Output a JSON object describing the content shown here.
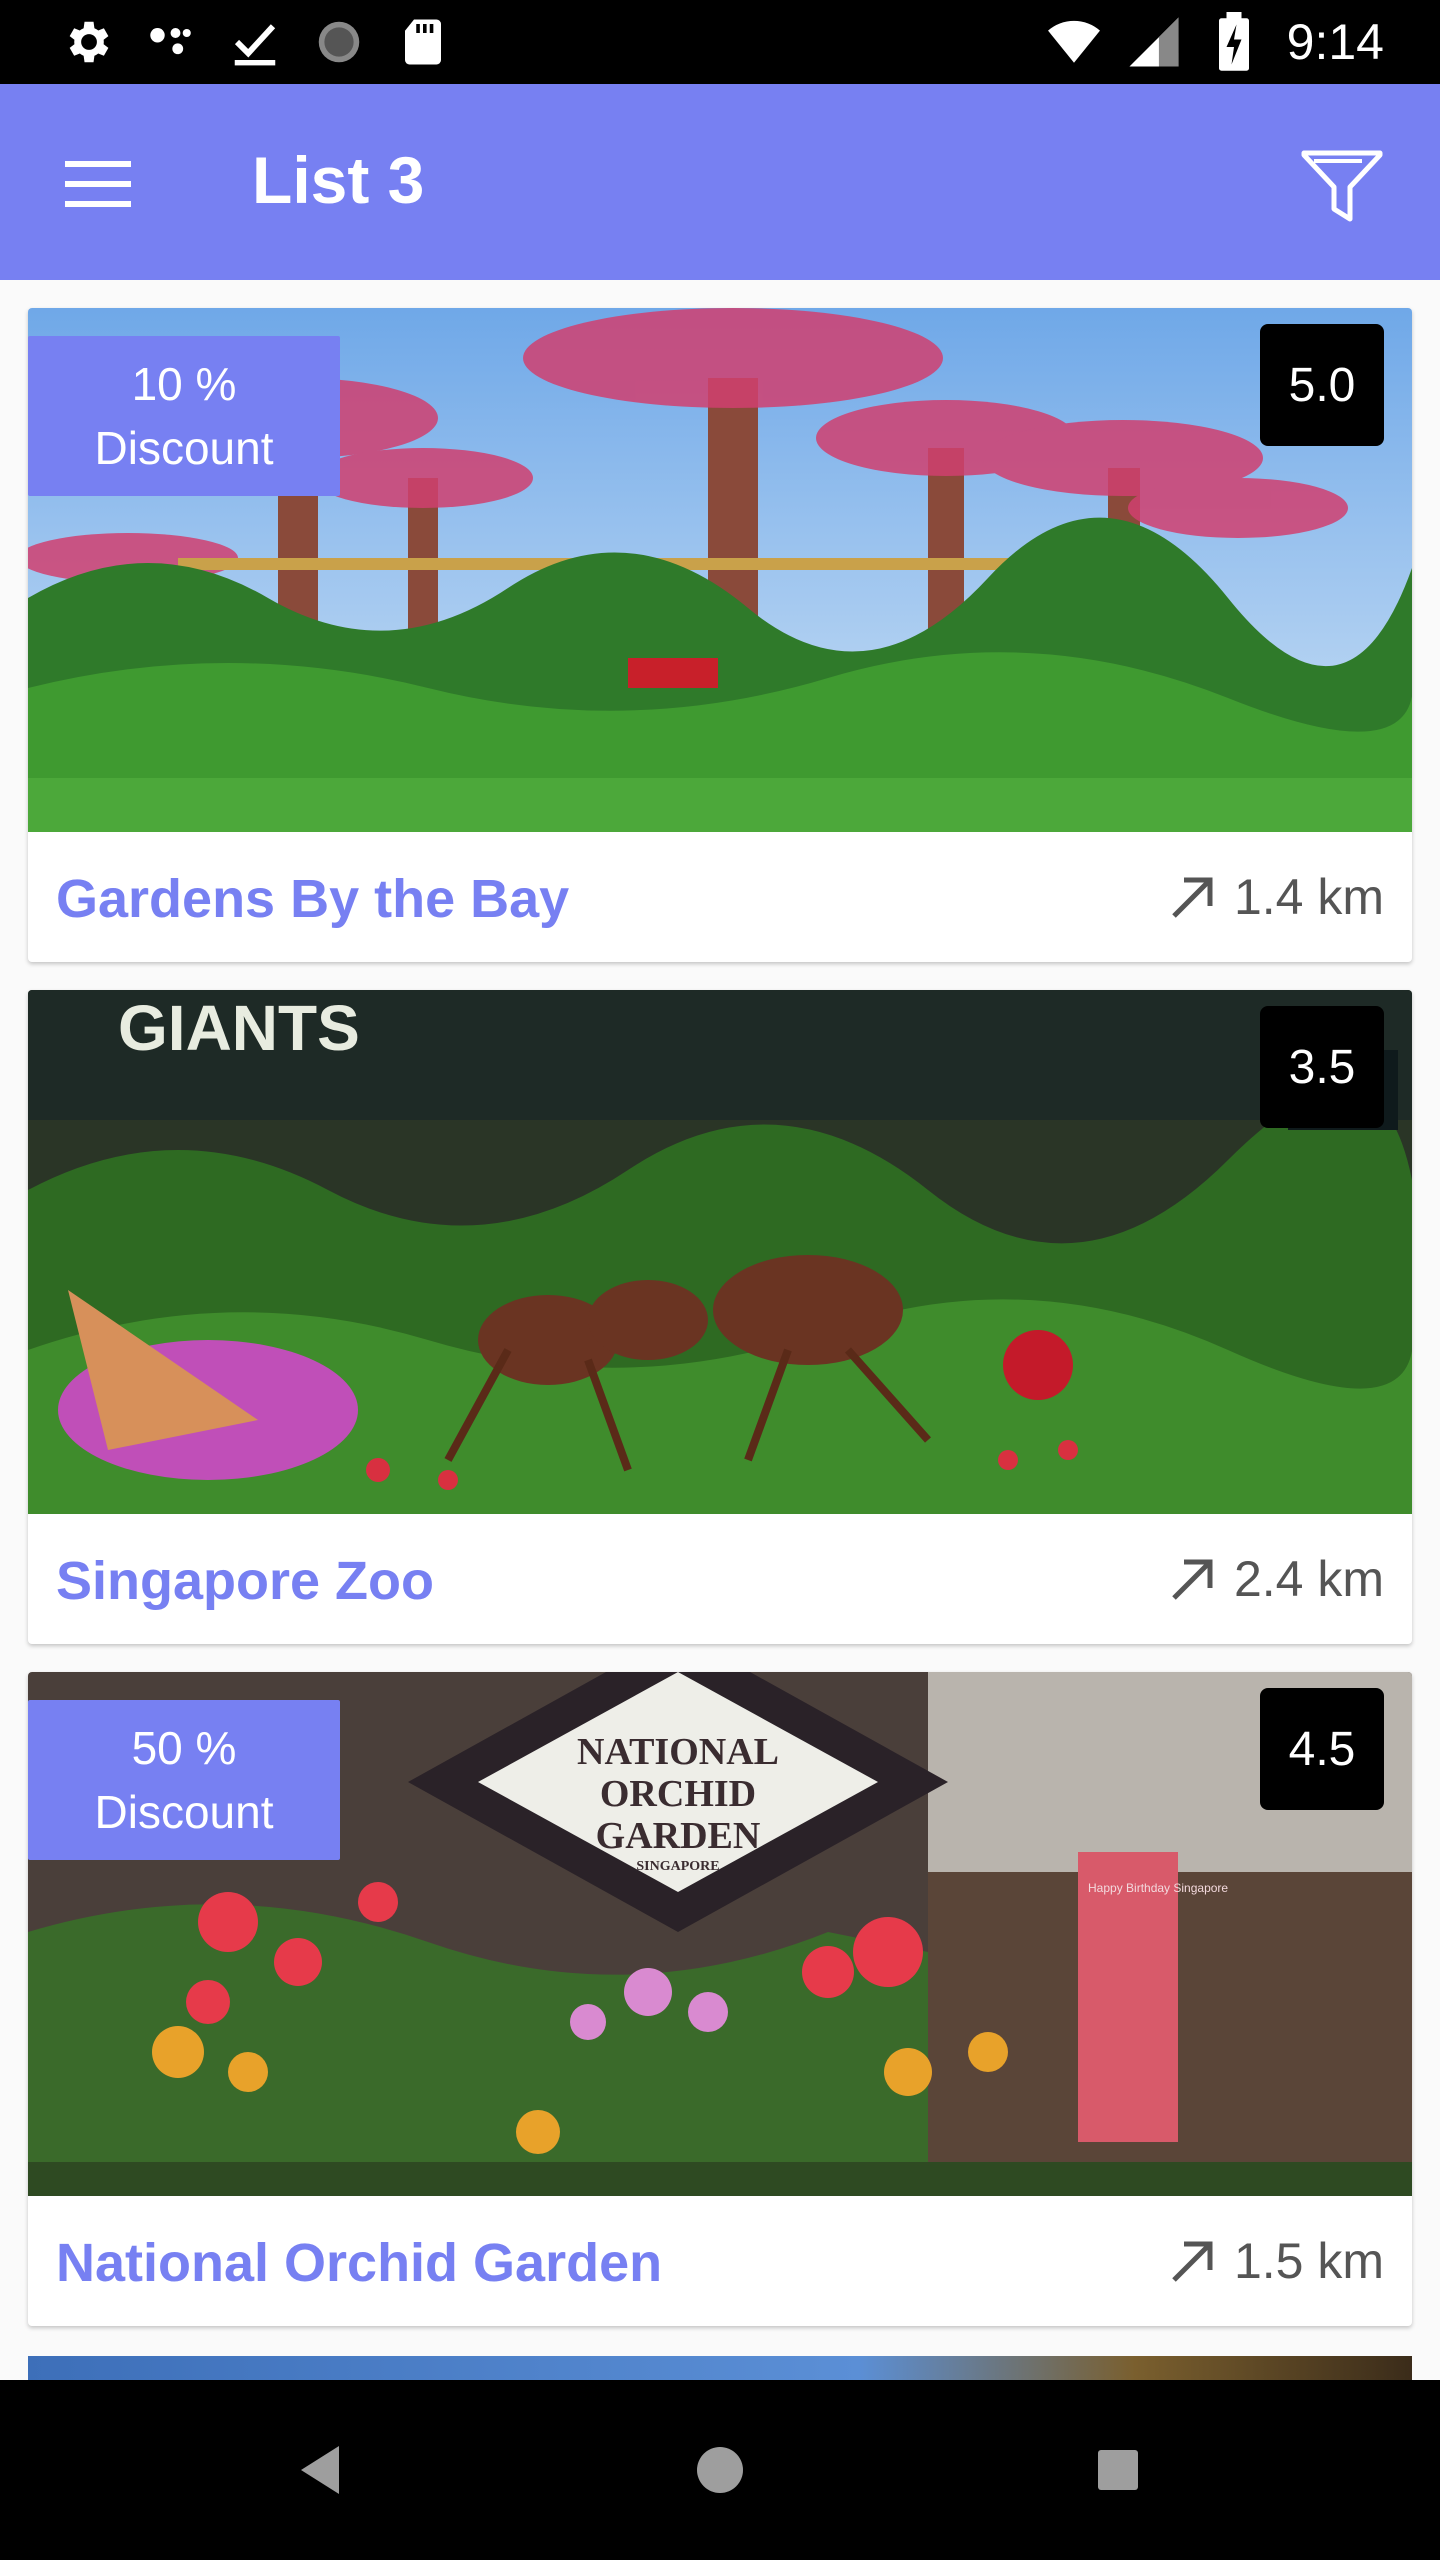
{
  "status_bar": {
    "time": "9:14",
    "left_icons": [
      "settings-icon",
      "assistant-icon",
      "download-done-icon",
      "sync-icon",
      "sd-card-icon"
    ],
    "right_icons": [
      "wifi-icon",
      "signal-icon",
      "battery-charging-icon"
    ]
  },
  "app_bar": {
    "title": "List 3",
    "menu_icon": "hamburger-menu-icon",
    "filter_icon": "filter-icon",
    "color": "#7780f2"
  },
  "items": [
    {
      "title": "Gardens By the Bay",
      "distance": "1.4 km",
      "rating": "5.0",
      "discount_value": "10 %",
      "discount_label": "Discount"
    },
    {
      "title": "Singapore Zoo",
      "distance": "2.4 km",
      "rating": "3.5"
    },
    {
      "title": "National Orchid Garden",
      "distance": "1.5 km",
      "rating": "4.5",
      "discount_value": "50 %",
      "discount_label": "Discount"
    }
  ],
  "photo_signs": {
    "zoo": "GIANTS",
    "orchid": [
      "NATIONAL",
      "ORCHID",
      "GARDEN",
      "SINGAPORE"
    ],
    "orchid_board": "Happy Birthday Singapore"
  },
  "nav_bar": {
    "buttons": [
      "back-icon",
      "home-icon",
      "recents-icon"
    ]
  }
}
